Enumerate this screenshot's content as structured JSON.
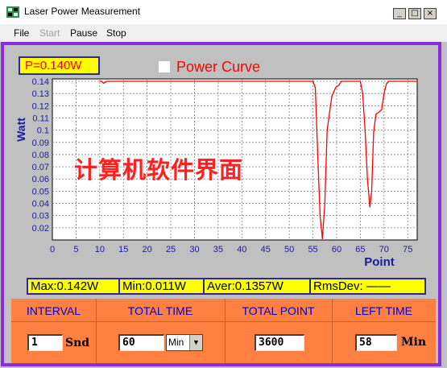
{
  "window": {
    "title": "Laser Power Measurement",
    "min_glyph": "_",
    "max_glyph": "□",
    "close_glyph": "×"
  },
  "menu": {
    "items": [
      {
        "label": "File",
        "enabled": true
      },
      {
        "label": "Start",
        "enabled": false
      },
      {
        "label": "Pause",
        "enabled": true
      },
      {
        "label": "Stop",
        "enabled": true
      }
    ]
  },
  "power_readout": "P=0.140W",
  "watermark": "计算机软件界面",
  "chart_data": {
    "type": "line",
    "title": "Power Curve",
    "xlabel": "Point",
    "ylabel": "Watt",
    "xlim": [
      0,
      77
    ],
    "ylim": [
      0.01,
      0.142
    ],
    "x_ticks": [
      0,
      5,
      10,
      15,
      20,
      25,
      30,
      35,
      40,
      45,
      50,
      55,
      60,
      65,
      70,
      75
    ],
    "y_ticks": [
      0.02,
      0.03,
      0.04,
      0.05,
      0.06,
      0.07,
      0.08,
      0.09,
      0.1,
      0.11,
      0.12,
      0.13,
      0.14
    ],
    "y_tick_labels": [
      "0.02",
      "0.03",
      "0.04",
      "0.05",
      "0.06",
      "0.07",
      "0.08",
      "0.09",
      "0.1",
      "0.11",
      "0.12",
      "0.13",
      "0.14"
    ],
    "grid": true,
    "color": "#ff0000",
    "series": [
      {
        "x": [
          10,
          10.4,
          10.8,
          11.5,
          12,
          20,
          30,
          40,
          50,
          55,
          55.5,
          56,
          56.5,
          57,
          57.5,
          58,
          59,
          59.8,
          60.5,
          61,
          62,
          65,
          65.5,
          66,
          66.5,
          67,
          67.4,
          67.8,
          68.3,
          69,
          69.5,
          70,
          70.5,
          71,
          72,
          74,
          76,
          77
        ],
        "y": [
          0.14,
          0.14,
          0.1385,
          0.14,
          0.14,
          0.14,
          0.14,
          0.14,
          0.14,
          0.14,
          0.135,
          0.08,
          0.03,
          0.011,
          0.04,
          0.1,
          0.128,
          0.135,
          0.137,
          0.14,
          0.14,
          0.14,
          0.13,
          0.1,
          0.06,
          0.037,
          0.05,
          0.098,
          0.113,
          0.115,
          0.117,
          0.13,
          0.138,
          0.14,
          0.14,
          0.14,
          0.14,
          0.14
        ]
      }
    ]
  },
  "stats": {
    "max": "Max:0.142W",
    "min": "Min:0.011W",
    "aver": "Aver:0.1357W",
    "rmsdev": "RmsDev: ——"
  },
  "controls": {
    "interval_header": "INTERVAL",
    "total_time_header": "TOTAL TIME",
    "total_point_header": "TOTAL POINT",
    "left_time_header": "LEFT TIME",
    "interval_value": "1",
    "interval_unit": "Snd",
    "total_time_value": "60",
    "total_time_unit": "Min",
    "total_point_value": "3600",
    "left_time_value": "58",
    "left_time_unit": "Min"
  }
}
